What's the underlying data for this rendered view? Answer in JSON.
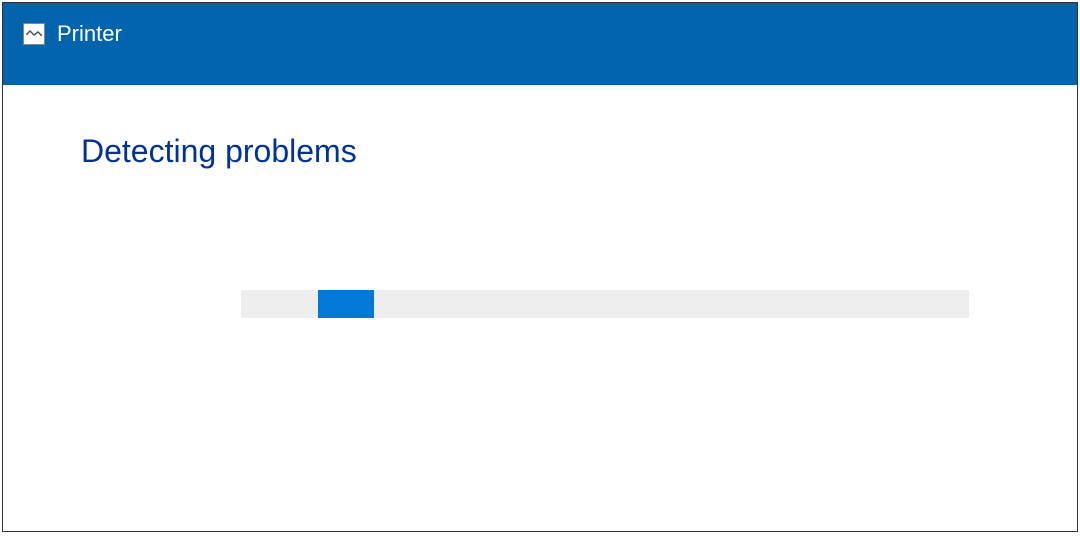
{
  "titlebar": {
    "title": "Printer",
    "icon": "printer-troubleshooter-icon"
  },
  "content": {
    "heading": "Detecting problems"
  },
  "progress": {
    "indeterminate": true,
    "position_percent": 10,
    "width_percent": 8
  },
  "colors": {
    "titlebar_bg": "#0164ad",
    "heading_text": "#003399",
    "progress_track": "#eeeeee",
    "progress_fill": "#0078d7"
  }
}
